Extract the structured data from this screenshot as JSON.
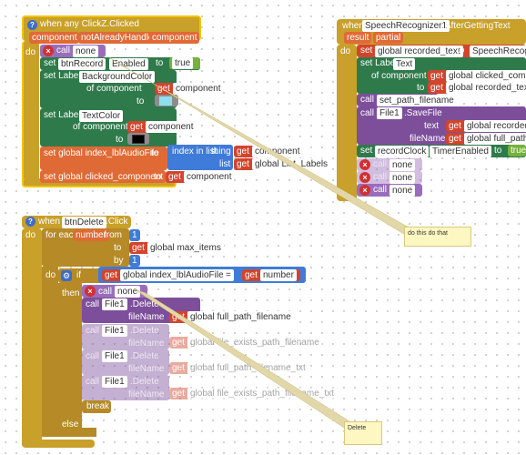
{
  "block1": {
    "header": "when any ClickZ.Clicked",
    "params": [
      "component",
      "notAlreadyHandled",
      "component"
    ],
    "do": "do",
    "call": "call",
    "none": "none",
    "set": "set",
    "btnRecord": "btnRecord",
    "enabled": "Enabled",
    "to": "to",
    "true": "true",
    "setLabel": "set Label.",
    "bgColor": "BackgroundColor",
    "ofComponent": "of component",
    "get": "get",
    "component": "component",
    "textColor": "TextColor",
    "setGlobal1": "set global index_lblAudioFile",
    "indexInList": "index in list",
    "thing": "thing",
    "list": "list",
    "listLabels": "global List_Labels",
    "setGlobal2": "set global clicked_component",
    "colors": {
      "cyan": "#8ee0ee",
      "black": "#000000"
    }
  },
  "block2": {
    "when": "when",
    "component": "SpeechRecognizer1",
    "event": ".AfterGettingText",
    "params": [
      "result",
      "partial"
    ],
    "do": "do",
    "set": "set",
    "recordedText": "global recorded_text",
    "to": "to",
    "speechRecog": "SpeechRecogniz",
    "setLabel": "set Label.",
    "text": "Text",
    "ofComponent": "of component",
    "get": "get",
    "clickedComponent": "global clicked_componer",
    "getRecordedText": "global recorded_text",
    "call": "call",
    "setPathFilename": "set_path_filename",
    "file1": "File1",
    "saveFile": ".SaveFile",
    "textLbl": "text",
    "fileName": "fileName",
    "recordedTe": "global recorded_te",
    "fullPath": "global full_path_fi",
    "recordClock": "recordClock",
    "timerEnabled": "TimerEnabled",
    "true": "true",
    "none": "none"
  },
  "block3": {
    "when": "when",
    "component": "btnDelete",
    "event": ".Click",
    "do": "do",
    "forEach": "for each",
    "number": "number",
    "from": "from",
    "one": "1",
    "to": "to",
    "maxItems": "global max_items",
    "by": "by",
    "if": "if",
    "then": "then",
    "else": "else",
    "get": "get",
    "indexAudio": "global index_lblAudioFile",
    "eq": "=",
    "call": "call",
    "none": "none",
    "file1": "File1",
    "delete": ".Delete",
    "fileName": "fileName",
    "fullPathFilename": "global full_path_filename",
    "fileExists": "global file_exists_path_filename",
    "fullPathTxt": "global full_path_filename_txt",
    "fileExistsTxt": "global file_exists_path_filename_txt",
    "break": "break"
  },
  "comments": {
    "one": "do this do that",
    "two": "Delete"
  }
}
